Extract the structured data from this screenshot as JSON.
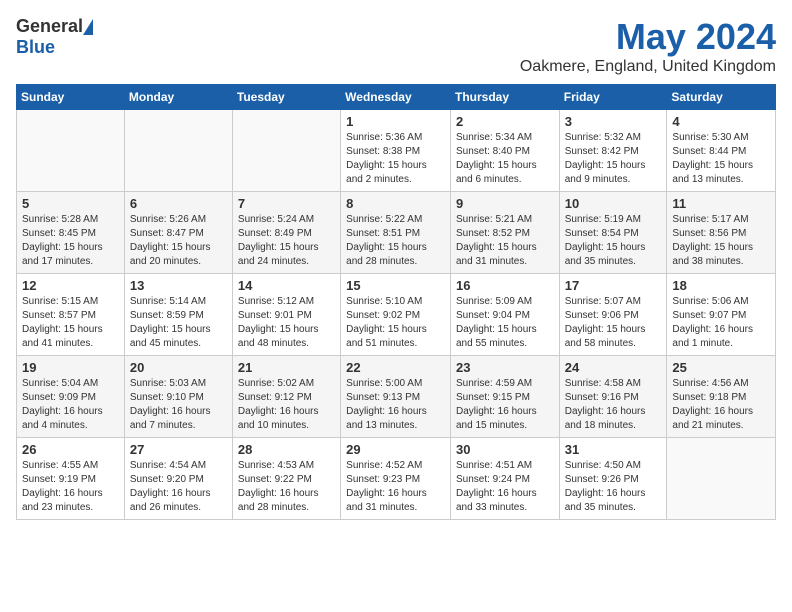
{
  "header": {
    "logo_general": "General",
    "logo_blue": "Blue",
    "month_title": "May 2024",
    "location": "Oakmere, England, United Kingdom"
  },
  "days_of_week": [
    "Sunday",
    "Monday",
    "Tuesday",
    "Wednesday",
    "Thursday",
    "Friday",
    "Saturday"
  ],
  "weeks": [
    [
      {
        "day": "",
        "info": ""
      },
      {
        "day": "",
        "info": ""
      },
      {
        "day": "",
        "info": ""
      },
      {
        "day": "1",
        "info": "Sunrise: 5:36 AM\nSunset: 8:38 PM\nDaylight: 15 hours\nand 2 minutes."
      },
      {
        "day": "2",
        "info": "Sunrise: 5:34 AM\nSunset: 8:40 PM\nDaylight: 15 hours\nand 6 minutes."
      },
      {
        "day": "3",
        "info": "Sunrise: 5:32 AM\nSunset: 8:42 PM\nDaylight: 15 hours\nand 9 minutes."
      },
      {
        "day": "4",
        "info": "Sunrise: 5:30 AM\nSunset: 8:44 PM\nDaylight: 15 hours\nand 13 minutes."
      }
    ],
    [
      {
        "day": "5",
        "info": "Sunrise: 5:28 AM\nSunset: 8:45 PM\nDaylight: 15 hours\nand 17 minutes."
      },
      {
        "day": "6",
        "info": "Sunrise: 5:26 AM\nSunset: 8:47 PM\nDaylight: 15 hours\nand 20 minutes."
      },
      {
        "day": "7",
        "info": "Sunrise: 5:24 AM\nSunset: 8:49 PM\nDaylight: 15 hours\nand 24 minutes."
      },
      {
        "day": "8",
        "info": "Sunrise: 5:22 AM\nSunset: 8:51 PM\nDaylight: 15 hours\nand 28 minutes."
      },
      {
        "day": "9",
        "info": "Sunrise: 5:21 AM\nSunset: 8:52 PM\nDaylight: 15 hours\nand 31 minutes."
      },
      {
        "day": "10",
        "info": "Sunrise: 5:19 AM\nSunset: 8:54 PM\nDaylight: 15 hours\nand 35 minutes."
      },
      {
        "day": "11",
        "info": "Sunrise: 5:17 AM\nSunset: 8:56 PM\nDaylight: 15 hours\nand 38 minutes."
      }
    ],
    [
      {
        "day": "12",
        "info": "Sunrise: 5:15 AM\nSunset: 8:57 PM\nDaylight: 15 hours\nand 41 minutes."
      },
      {
        "day": "13",
        "info": "Sunrise: 5:14 AM\nSunset: 8:59 PM\nDaylight: 15 hours\nand 45 minutes."
      },
      {
        "day": "14",
        "info": "Sunrise: 5:12 AM\nSunset: 9:01 PM\nDaylight: 15 hours\nand 48 minutes."
      },
      {
        "day": "15",
        "info": "Sunrise: 5:10 AM\nSunset: 9:02 PM\nDaylight: 15 hours\nand 51 minutes."
      },
      {
        "day": "16",
        "info": "Sunrise: 5:09 AM\nSunset: 9:04 PM\nDaylight: 15 hours\nand 55 minutes."
      },
      {
        "day": "17",
        "info": "Sunrise: 5:07 AM\nSunset: 9:06 PM\nDaylight: 15 hours\nand 58 minutes."
      },
      {
        "day": "18",
        "info": "Sunrise: 5:06 AM\nSunset: 9:07 PM\nDaylight: 16 hours\nand 1 minute."
      }
    ],
    [
      {
        "day": "19",
        "info": "Sunrise: 5:04 AM\nSunset: 9:09 PM\nDaylight: 16 hours\nand 4 minutes."
      },
      {
        "day": "20",
        "info": "Sunrise: 5:03 AM\nSunset: 9:10 PM\nDaylight: 16 hours\nand 7 minutes."
      },
      {
        "day": "21",
        "info": "Sunrise: 5:02 AM\nSunset: 9:12 PM\nDaylight: 16 hours\nand 10 minutes."
      },
      {
        "day": "22",
        "info": "Sunrise: 5:00 AM\nSunset: 9:13 PM\nDaylight: 16 hours\nand 13 minutes."
      },
      {
        "day": "23",
        "info": "Sunrise: 4:59 AM\nSunset: 9:15 PM\nDaylight: 16 hours\nand 15 minutes."
      },
      {
        "day": "24",
        "info": "Sunrise: 4:58 AM\nSunset: 9:16 PM\nDaylight: 16 hours\nand 18 minutes."
      },
      {
        "day": "25",
        "info": "Sunrise: 4:56 AM\nSunset: 9:18 PM\nDaylight: 16 hours\nand 21 minutes."
      }
    ],
    [
      {
        "day": "26",
        "info": "Sunrise: 4:55 AM\nSunset: 9:19 PM\nDaylight: 16 hours\nand 23 minutes."
      },
      {
        "day": "27",
        "info": "Sunrise: 4:54 AM\nSunset: 9:20 PM\nDaylight: 16 hours\nand 26 minutes."
      },
      {
        "day": "28",
        "info": "Sunrise: 4:53 AM\nSunset: 9:22 PM\nDaylight: 16 hours\nand 28 minutes."
      },
      {
        "day": "29",
        "info": "Sunrise: 4:52 AM\nSunset: 9:23 PM\nDaylight: 16 hours\nand 31 minutes."
      },
      {
        "day": "30",
        "info": "Sunrise: 4:51 AM\nSunset: 9:24 PM\nDaylight: 16 hours\nand 33 minutes."
      },
      {
        "day": "31",
        "info": "Sunrise: 4:50 AM\nSunset: 9:26 PM\nDaylight: 16 hours\nand 35 minutes."
      },
      {
        "day": "",
        "info": ""
      }
    ]
  ]
}
